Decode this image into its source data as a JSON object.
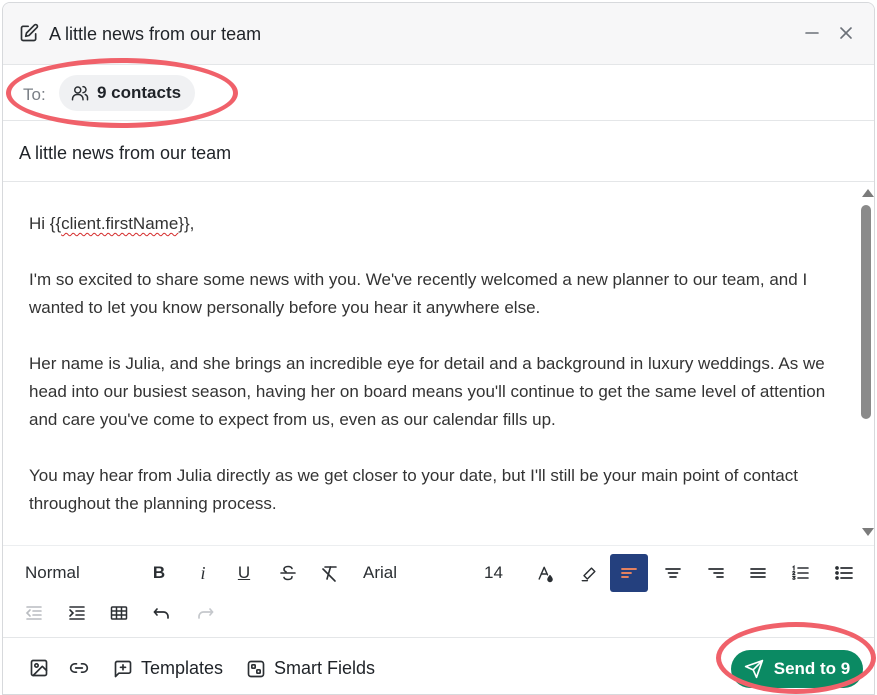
{
  "header": {
    "title": "A little news from our team"
  },
  "recipients": {
    "to_label": "To:",
    "contacts_label": "9 contacts"
  },
  "subject": {
    "value": "A little news from our team"
  },
  "body": {
    "greeting_prefix": "Hi {{",
    "greeting_token": "client.firstName",
    "greeting_suffix": "}},",
    "paragraphs": [
      "I'm so excited to share some news with you. We've recently welcomed a new planner to our team, and I wanted to let you know personally before you hear it anywhere else.",
      "Her name is Julia, and she brings an incredible eye for detail and a background in luxury weddings. As we head into our busiest season, having her on board means you'll continue to get the same level of attention and care you've come to expect from us, even as our calendar fills up.",
      "You may hear from Julia directly as we get closer to your date, but I'll still be your main point of contact throughout the planning process."
    ]
  },
  "toolbar": {
    "style_select": "Normal",
    "font_select": "Arial",
    "size_select": "14",
    "icons": [
      "bold-icon",
      "italic-icon",
      "underline-icon",
      "strikethrough-icon",
      "clear-format-icon",
      "font-color-icon",
      "highlight-icon",
      "align-left-icon",
      "align-center-icon",
      "align-right-icon",
      "justify-icon",
      "numbered-list-icon",
      "bullet-list-icon",
      "outdent-icon",
      "indent-icon",
      "table-icon",
      "undo-icon",
      "redo-icon"
    ],
    "bold_glyph": "B",
    "italic_glyph": "i",
    "underline_glyph": "U"
  },
  "footer": {
    "templates_label": "Templates",
    "smart_fields_label": "Smart Fields",
    "send_label": "Send to 9"
  },
  "colors": {
    "send_button": "#0b8a63",
    "active_align": "#24407e",
    "highlight_ring": "#f0616a"
  }
}
